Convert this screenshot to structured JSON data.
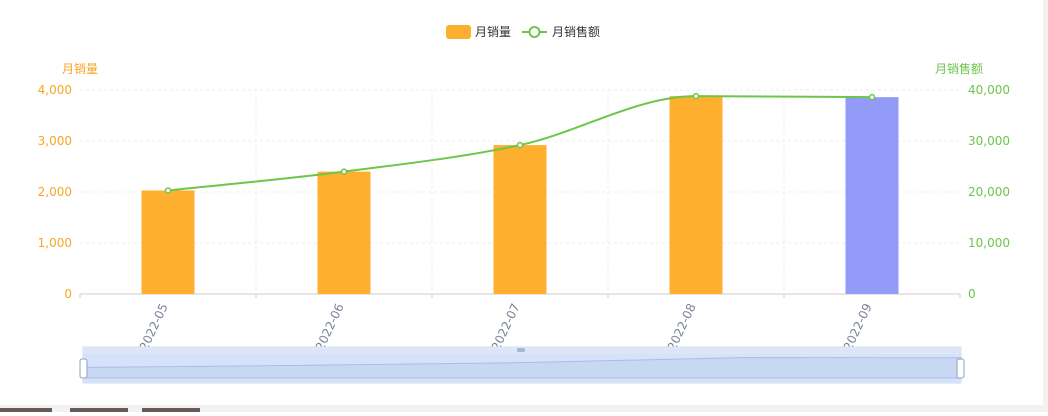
{
  "chart_data": {
    "type": "bar",
    "categories": [
      "2022-05",
      "2022-06",
      "2022-07",
      "2022-08",
      "2022-09"
    ],
    "series": [
      {
        "name": "月销量",
        "type": "bar",
        "axis": "left",
        "values": [
          2030,
          2400,
          2920,
          3880,
          3860
        ],
        "color": "#ffaf2e",
        "highlight_color": "#929cf8",
        "highlight_index": 4
      },
      {
        "name": "月销售额",
        "type": "line",
        "axis": "right",
        "smooth": true,
        "values": [
          20300,
          24000,
          29200,
          38800,
          38600
        ],
        "color": "#6dc54a"
      }
    ],
    "y_left": {
      "label": "月销量",
      "ylim": [
        0,
        4000
      ],
      "ticks": [
        "0",
        "1,000",
        "2,000",
        "3,000",
        "4,000"
      ],
      "color": "#f5a623"
    },
    "y_right": {
      "label": "月销售额",
      "ylim": [
        0,
        40000
      ],
      "ticks": [
        "0",
        "10,000",
        "20,000",
        "30,000",
        "40,000"
      ],
      "color": "#6dc54a"
    },
    "legend_position": "top-center",
    "grid": true,
    "data_zoom": {
      "start": 0,
      "end": 1
    }
  }
}
